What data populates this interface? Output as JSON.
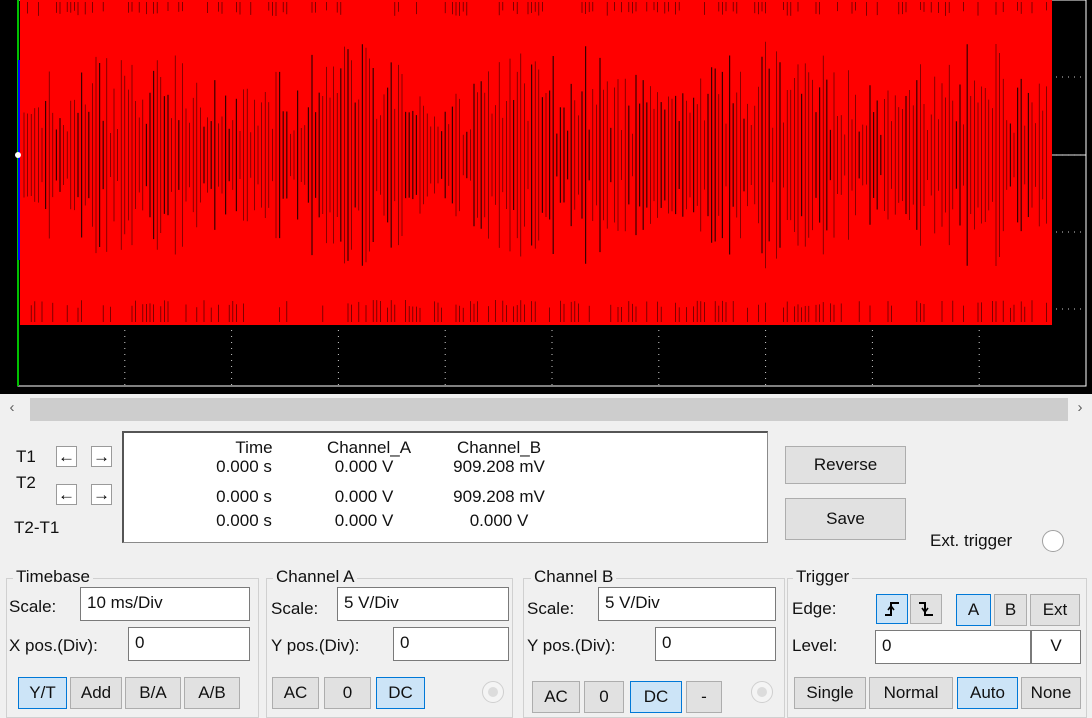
{
  "scope": {
    "trace_color": "#ff0000",
    "grid_color": "#ffffff",
    "background": "#000000",
    "channel_a_marker_color": "#00c000",
    "channel_b_marker_color": "#0000ff"
  },
  "readout": {
    "t1_label": "T1",
    "t2_label": "T2",
    "t2t1_label": "T2-T1",
    "headers": [
      "Time",
      "Channel_A",
      "Channel_B"
    ],
    "rows": [
      [
        "0.000 s",
        "0.000 V",
        "909.208 mV"
      ],
      [
        "0.000 s",
        "0.000 V",
        "909.208 mV"
      ],
      [
        "0.000 s",
        "0.000 V",
        "0.000 V"
      ]
    ]
  },
  "buttons": {
    "reverse": "Reverse",
    "save": "Save"
  },
  "ext_trigger_label": "Ext. trigger",
  "timebase": {
    "title": "Timebase",
    "scale_label": "Scale:",
    "scale_value": "10 ms/Div",
    "xpos_label": "X pos.(Div):",
    "xpos_value": "0",
    "modes": [
      "Y/T",
      "Add",
      "B/A",
      "A/B"
    ],
    "selected_mode": "Y/T"
  },
  "channel_a": {
    "title": "Channel A",
    "scale_label": "Scale:",
    "scale_value": "5  V/Div",
    "ypos_label": "Y pos.(Div):",
    "ypos_value": "0",
    "coupling": [
      "AC",
      "0",
      "DC"
    ],
    "selected": "DC"
  },
  "channel_b": {
    "title": "Channel B",
    "scale_label": "Scale:",
    "scale_value": "5  V/Div",
    "ypos_label": "Y pos.(Div):",
    "ypos_value": "0",
    "coupling": [
      "AC",
      "0",
      "DC",
      "-"
    ],
    "selected": "DC"
  },
  "trigger": {
    "title": "Trigger",
    "edge_label": "Edge:",
    "sources": [
      "A",
      "B",
      "Ext"
    ],
    "selected_source": "A",
    "level_label": "Level:",
    "level_value": "0",
    "level_unit": "V",
    "modes": [
      "Single",
      "Normal",
      "Auto",
      "None"
    ],
    "selected_mode": "Auto"
  }
}
